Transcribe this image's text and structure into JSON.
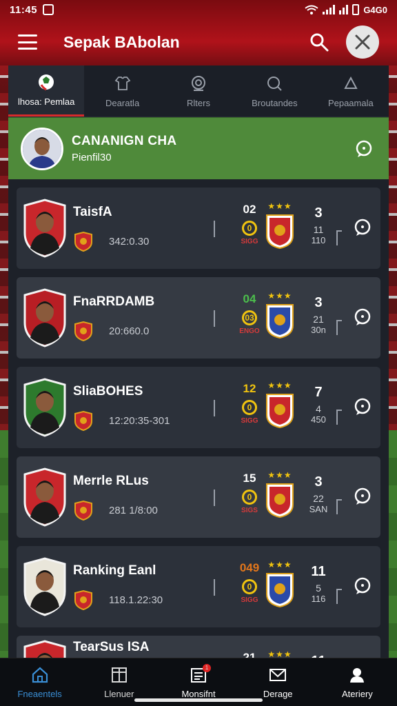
{
  "status_bar": {
    "time": "11:45",
    "battery": "G4G0"
  },
  "header": {
    "title": "Sepak BAbolan"
  },
  "tabs": [
    {
      "label": "lhosa: Pemlaa",
      "icon": "ball-icon",
      "active": true
    },
    {
      "label": "Dearatla",
      "icon": "shirt-icon",
      "active": false
    },
    {
      "label": "Rlters",
      "icon": "target-icon",
      "active": false
    },
    {
      "label": "Broutandes",
      "icon": "search-icon",
      "active": false
    },
    {
      "label": "Pepaamala",
      "icon": "trophy-icon",
      "active": false
    }
  ],
  "featured": {
    "title": "CANANIGN CHA",
    "subtitle": "Pienfil30"
  },
  "players": [
    {
      "name": "TaisfA",
      "stat": "342:0.30",
      "score_top": "02",
      "score_badge": "0",
      "score_bottom": "SIGG",
      "rank_top": "3",
      "rank_mid": "11",
      "rank_bot": "110",
      "score_color": "#ffffff"
    },
    {
      "name": "FnaRRDAMB",
      "stat": "20:660.0",
      "score_top": "04",
      "score_badge": "03",
      "score_bottom": "ENGO",
      "rank_top": "3",
      "rank_mid": "21",
      "rank_bot": "30n",
      "score_color": "#4cbf4c"
    },
    {
      "name": "SliaBOHES",
      "stat": "12:20:35-301",
      "score_top": "12",
      "score_badge": "0",
      "score_bottom": "SIGG",
      "rank_top": "7",
      "rank_mid": "4",
      "rank_bot": "450",
      "score_color": "#f1c40f"
    },
    {
      "name": "Merrle RLus",
      "stat": "281 1/8:00",
      "score_top": "15",
      "score_badge": "0",
      "score_bottom": "SIGS",
      "rank_top": "3",
      "rank_mid": "22",
      "rank_bot": "SAN",
      "score_color": "#ffffff"
    },
    {
      "name": "Ranking Eanl",
      "stat": "118.1.22:30",
      "score_top": "049",
      "score_badge": "0",
      "score_bottom": "SIGG",
      "rank_top": "11",
      "rank_mid": "5",
      "rank_bot": "116",
      "score_color": "#e2761b"
    },
    {
      "name": "TearSus ISA",
      "stat": "",
      "score_top": "21",
      "score_badge": "",
      "score_bottom": "",
      "rank_top": "11",
      "rank_mid": "",
      "rank_bot": "",
      "score_color": "#ffffff"
    }
  ],
  "bottom_nav": [
    {
      "label": "Fneaentels",
      "icon": "home-icon",
      "active": true
    },
    {
      "label": "Llenuer",
      "icon": "calendar-icon",
      "active": false
    },
    {
      "label": "Monsifnt",
      "icon": "news-icon",
      "active": false,
      "badge": "1"
    },
    {
      "label": "Derage",
      "icon": "mail-icon",
      "active": false
    },
    {
      "label": "Ateriery",
      "icon": "profile-icon",
      "active": false
    }
  ],
  "colors": {
    "accent": "#d62b2b",
    "featured_bg": "#4f8a3a",
    "nav_active": "#3a8fd6",
    "star": "#f1c40f"
  }
}
